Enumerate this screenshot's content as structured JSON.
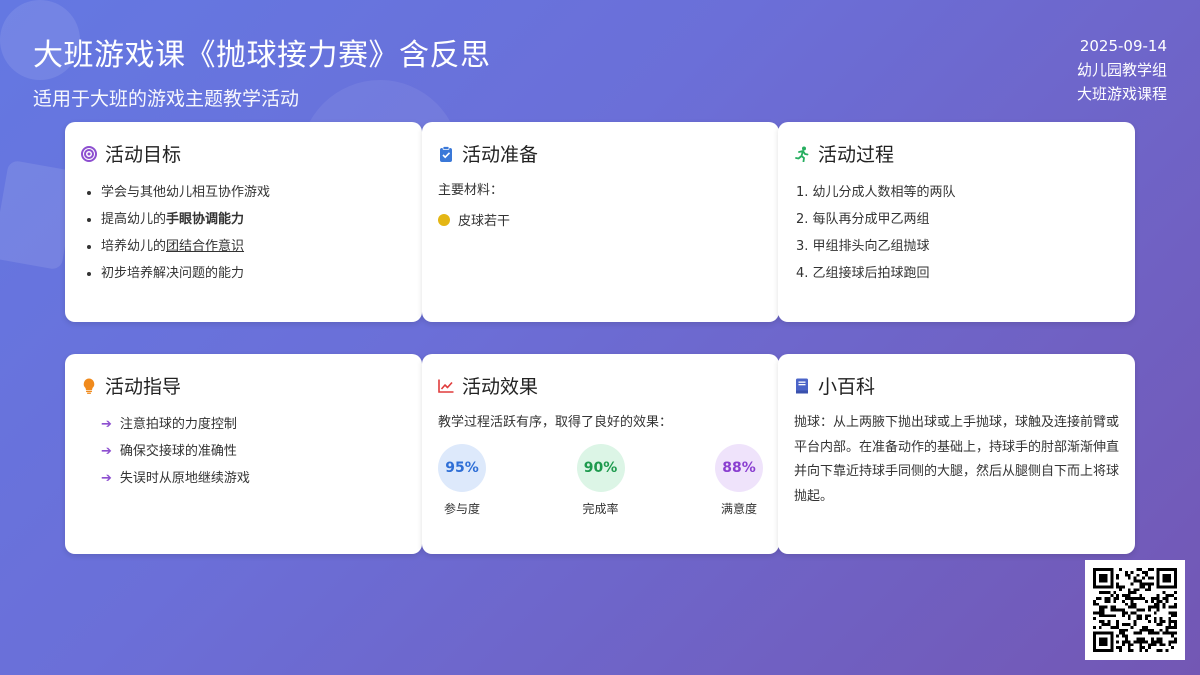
{
  "header": {
    "title": "大班游戏课《抛球接力赛》含反思",
    "subtitle": "适用于大班的游戏主题教学活动"
  },
  "meta": {
    "date": "2025-09-14",
    "org": "幼儿园教学组",
    "course": "大班游戏课程"
  },
  "goals": {
    "title": "活动目标",
    "items": [
      {
        "pre": "学会与其他幼儿相互协作游戏",
        "em": "",
        "em_style": ""
      },
      {
        "pre": "提高幼儿的",
        "em": "手眼协调能力",
        "em_style": "bold"
      },
      {
        "pre": "培养幼儿的",
        "em": "团结合作意识",
        "em_style": "underline"
      },
      {
        "pre": "初步培养解决问题的能力",
        "em": "",
        "em_style": ""
      }
    ]
  },
  "prep": {
    "title": "活动准备",
    "label": "主要材料：",
    "material": "皮球若干"
  },
  "process": {
    "title": "活动过程",
    "steps": [
      "1. 幼儿分成人数相等的两队",
      "2. 每队再分成甲乙两组",
      "3. 甲组排头向乙组抛球",
      "4. 乙组接球后拍球跑回"
    ]
  },
  "guide": {
    "title": "活动指导",
    "items": [
      "注意拍球的力度控制",
      "确保交接球的准确性",
      "失误时从原地继续游戏"
    ]
  },
  "effect": {
    "title": "活动效果",
    "text": "教学过程活跃有序，取得了良好的效果：",
    "stats": [
      {
        "value": "95%",
        "label": "参与度",
        "color": "#2f6fd6",
        "bg": "#dde9fb"
      },
      {
        "value": "90%",
        "label": "完成率",
        "color": "#1e9a4e",
        "bg": "#dcf5e6"
      },
      {
        "value": "88%",
        "label": "满意度",
        "color": "#8a3fd0",
        "bg": "#efe3fb"
      }
    ]
  },
  "wiki": {
    "title": "小百科",
    "text": "抛球：从上两腋下抛出球或上手抛球，球触及连接前臂或平台内部。在准备动作的基础上，持球手的肘部渐渐伸直并向下靠近持球手同侧的大腿，然后从腿侧自下而上将球抛起。"
  },
  "icons": {
    "goals": "target-icon",
    "prep": "clipboard-icon",
    "process": "running-icon",
    "guide": "lightbulb-icon",
    "effect": "chart-line-icon",
    "wiki": "book-icon",
    "guide_bullet": "arrow-right-icon"
  }
}
